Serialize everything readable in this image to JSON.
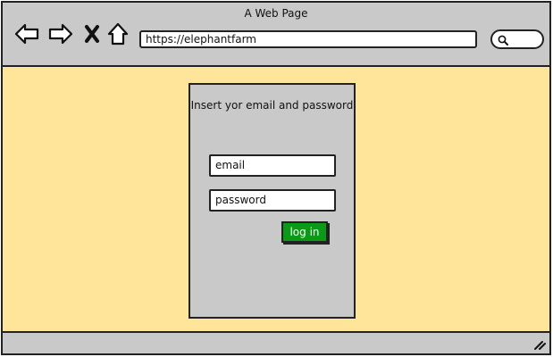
{
  "window": {
    "title": "A Web Page"
  },
  "toolbar": {
    "back_icon": "arrow-left-icon",
    "forward_icon": "arrow-right-icon",
    "close_icon": "x-icon",
    "home_icon": "home-icon",
    "search_icon": "magnifier-icon"
  },
  "address_bar": {
    "url": "https://elephantfarm"
  },
  "login": {
    "instruction": "Insert yor email and password",
    "email_value": "email",
    "password_value": "password",
    "button_label": "log in"
  },
  "colors": {
    "content_background": "#ffe599",
    "chrome": "#c9c9c9",
    "login_button": "#0a9a16"
  }
}
